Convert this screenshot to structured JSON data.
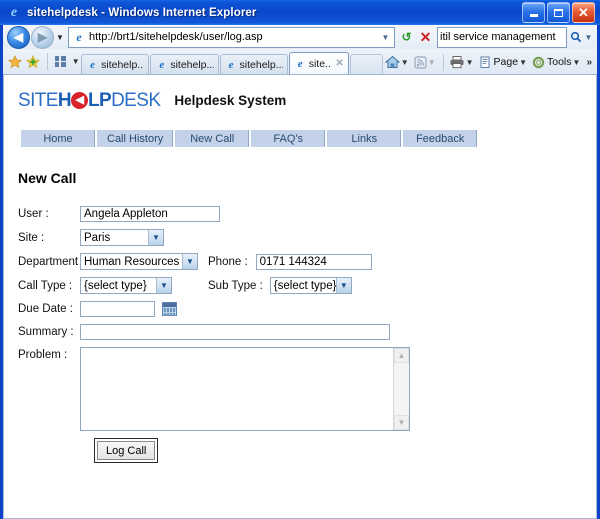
{
  "window": {
    "title": "sitehelpdesk - Windows Internet Explorer",
    "icon": "ie-logo-icon",
    "minimize_label": "Minimize",
    "maximize_label": "Maximize",
    "close_label": "Close"
  },
  "browser": {
    "back_label": "Back",
    "forward_label": "Forward",
    "history_dropdown_label": "Recent Pages",
    "address": {
      "url": "http://brt1/sitehelpdesk/user/log.asp",
      "dropdown_label": "Address dropdown"
    },
    "refresh_label": "Refresh",
    "stop_label": "Stop",
    "search": {
      "value": "itil service management",
      "go_label": "Search",
      "provider_dropdown_label": "Search provider"
    },
    "favorites_label": "Favorites Center",
    "add_favorites_label": "Add to Favorites",
    "quick_tabs_label": "Quick Tabs",
    "tab_list_label": "Tab List",
    "tabs": [
      {
        "label": "sitehelp...",
        "active": false,
        "closable": false
      },
      {
        "label": "sitehelp...",
        "active": false,
        "closable": false
      },
      {
        "label": "sitehelp...",
        "active": false,
        "closable": false
      },
      {
        "label": "site...",
        "active": true,
        "closable": true,
        "close_label": "✕"
      }
    ],
    "toolbar_right": [
      {
        "name": "home-icon",
        "label": "Home",
        "caret": true
      },
      {
        "name": "feeds-icon",
        "label": "Feeds",
        "caret": true
      },
      {
        "name": "print-icon",
        "label": "Print",
        "caret": true
      },
      {
        "name": "page-icon",
        "label": "Page",
        "caret": true
      },
      {
        "name": "tools-icon",
        "label": "Tools",
        "caret": true
      }
    ],
    "overflow_label": "»"
  },
  "site": {
    "logo": {
      "part1": "SITE",
      "part2": "H",
      "orb_glyph": "◀",
      "part3": "LP",
      "part4": "DESK"
    },
    "system_title": "Helpdesk System",
    "nav": [
      {
        "label": "Home"
      },
      {
        "label": "Call History"
      },
      {
        "label": "New Call"
      },
      {
        "label": "FAQ's"
      },
      {
        "label": "Links"
      },
      {
        "label": "Feedback"
      }
    ],
    "page_title": "New Call",
    "form": {
      "user": {
        "label": "User :",
        "value": "Angela Appleton"
      },
      "site": {
        "label": "Site :",
        "value": "Paris"
      },
      "department": {
        "label": "Department :",
        "value": "Human Resources"
      },
      "phone": {
        "label": "Phone :",
        "value": "0171 144324"
      },
      "call_type": {
        "label": "Call Type :",
        "value": "{select type}"
      },
      "sub_type": {
        "label": "Sub Type :",
        "value": "{select type}"
      },
      "due_date": {
        "label": "Due Date :",
        "value": "",
        "picker_label": "calendar-icon"
      },
      "summary": {
        "label": "Summary :",
        "value": ""
      },
      "problem": {
        "label": "Problem :",
        "value": ""
      },
      "submit": {
        "label": "Log Call"
      }
    }
  },
  "glyphs": {
    "caret_down": "▾",
    "arrow_left": "◀",
    "arrow_right": "▶",
    "refresh": "↻",
    "stop": "✕",
    "magnifier": "⚲",
    "scroll_up": "▴",
    "scroll_down": "▾",
    "star": "★",
    "plus": "✚",
    "home": "⌂",
    "feed": "◔",
    "print": "⎙",
    "page": "⎘",
    "tools": "⚙"
  }
}
